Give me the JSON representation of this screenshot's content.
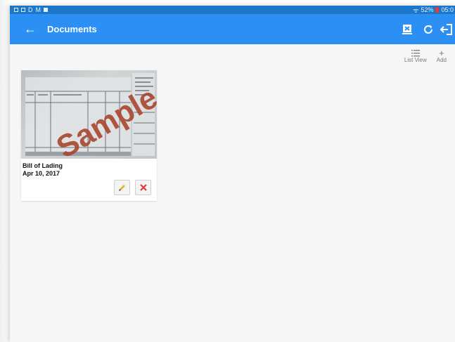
{
  "status_bar": {
    "left_icons": [
      "notification-square",
      "message-square"
    ],
    "letters": [
      "D",
      "M"
    ],
    "battery_percent": "52%",
    "time": "05:0"
  },
  "app_bar": {
    "back_icon": "arrow-left-icon",
    "title": "Documents",
    "colors": {
      "appbar": "#2b8ff3",
      "statusbar": "#1a77c9"
    }
  },
  "toolbar": {
    "list_view_label": "List View",
    "add_label": "Add"
  },
  "documents": [
    {
      "name": "Bill of Lading",
      "date": "Apr 10, 2017",
      "watermark": "Sample"
    }
  ]
}
